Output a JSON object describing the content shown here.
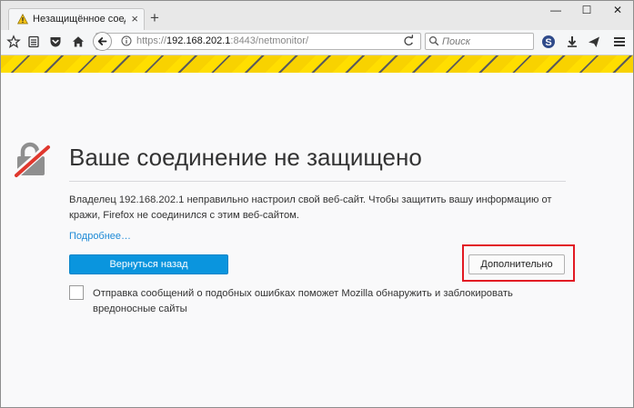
{
  "tab": {
    "title": "Незащищённое соедине…",
    "close": "×"
  },
  "window": {
    "new_tab": "+",
    "minimize": "—",
    "maximize": "☐",
    "close": "✕"
  },
  "urlbar": {
    "scheme": "https://",
    "host": "192.168.202.1",
    "rest": ":8443/netmonitor/"
  },
  "search": {
    "placeholder": "Поиск"
  },
  "page": {
    "title": "Ваше соединение не защищено",
    "description": "Владелец 192.168.202.1 неправильно настроил свой веб-сайт. Чтобы защитить вашу информацию от кражи, Firefox не соединился с этим веб-сайтом.",
    "learn_more": "Подробнее…",
    "go_back_button": "Вернуться назад",
    "advanced_button": "Дополнительно",
    "report_checkbox_label": "Отправка сообщений о подобных ошибках поможет Mozilla обнаружить и заблокировать вредоносные сайты",
    "report_checked": false
  },
  "icons": {
    "tab": "warning-icon",
    "toolbar": [
      "bookmark-star-icon",
      "reader-view-icon",
      "pocket-icon",
      "home-icon"
    ],
    "back": "back-arrow-icon",
    "url_info": "info-icon",
    "reload": "reload-icon",
    "search": "search-icon",
    "right_toolbar": [
      "extension-s-icon",
      "download-icon",
      "send-icon",
      "menu-icon"
    ],
    "page": "broken-lock-icon"
  },
  "colors": {
    "stripe_yellow": "#f8d200",
    "primary_button": "#0a95de",
    "highlight_frame": "#e21a23",
    "link": "#1e8ad6"
  }
}
